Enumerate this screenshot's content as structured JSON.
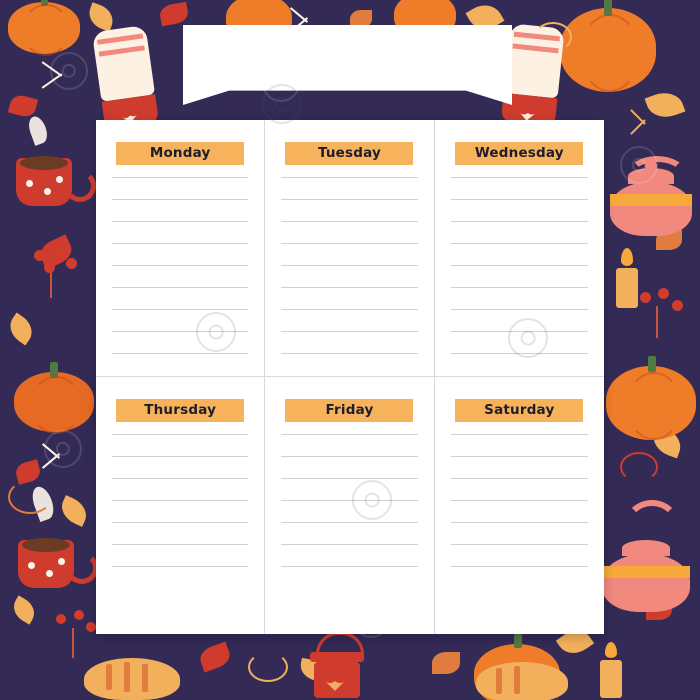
{
  "page": {
    "title": "Autumn Weekly Planner",
    "background_color": "#332a56",
    "sheet_color": "#ffffff",
    "accent_color": "#f7b25c",
    "rule_color": "#cfcfd8"
  },
  "banner": {
    "text": "",
    "note": "blank white ribbon banner for a title"
  },
  "planner": {
    "days": [
      {
        "label": "Monday",
        "lines": 9
      },
      {
        "label": "Tuesday",
        "lines": 9
      },
      {
        "label": "Wednesday",
        "lines": 9
      },
      {
        "label": "Thursday",
        "lines": 7
      },
      {
        "label": "Friday",
        "lines": 7
      },
      {
        "label": "Saturday",
        "lines": 7
      }
    ]
  },
  "decor": {
    "motifs": [
      "pumpkin",
      "autumn-leaf",
      "oak-leaf",
      "berry-branch",
      "coffee-mug",
      "teapot",
      "candle",
      "knitted-sock",
      "mitten",
      "sleeping-cat",
      "lantern",
      "heart"
    ],
    "colors": {
      "pumpkin_orange": "#ef7c28",
      "leaf_orange": "#f2b05c",
      "leaf_red": "#cf3b2d",
      "cream": "#fdf1e3",
      "teapot_pink": "#f1897f",
      "stem_green": "#4f7a43"
    }
  }
}
